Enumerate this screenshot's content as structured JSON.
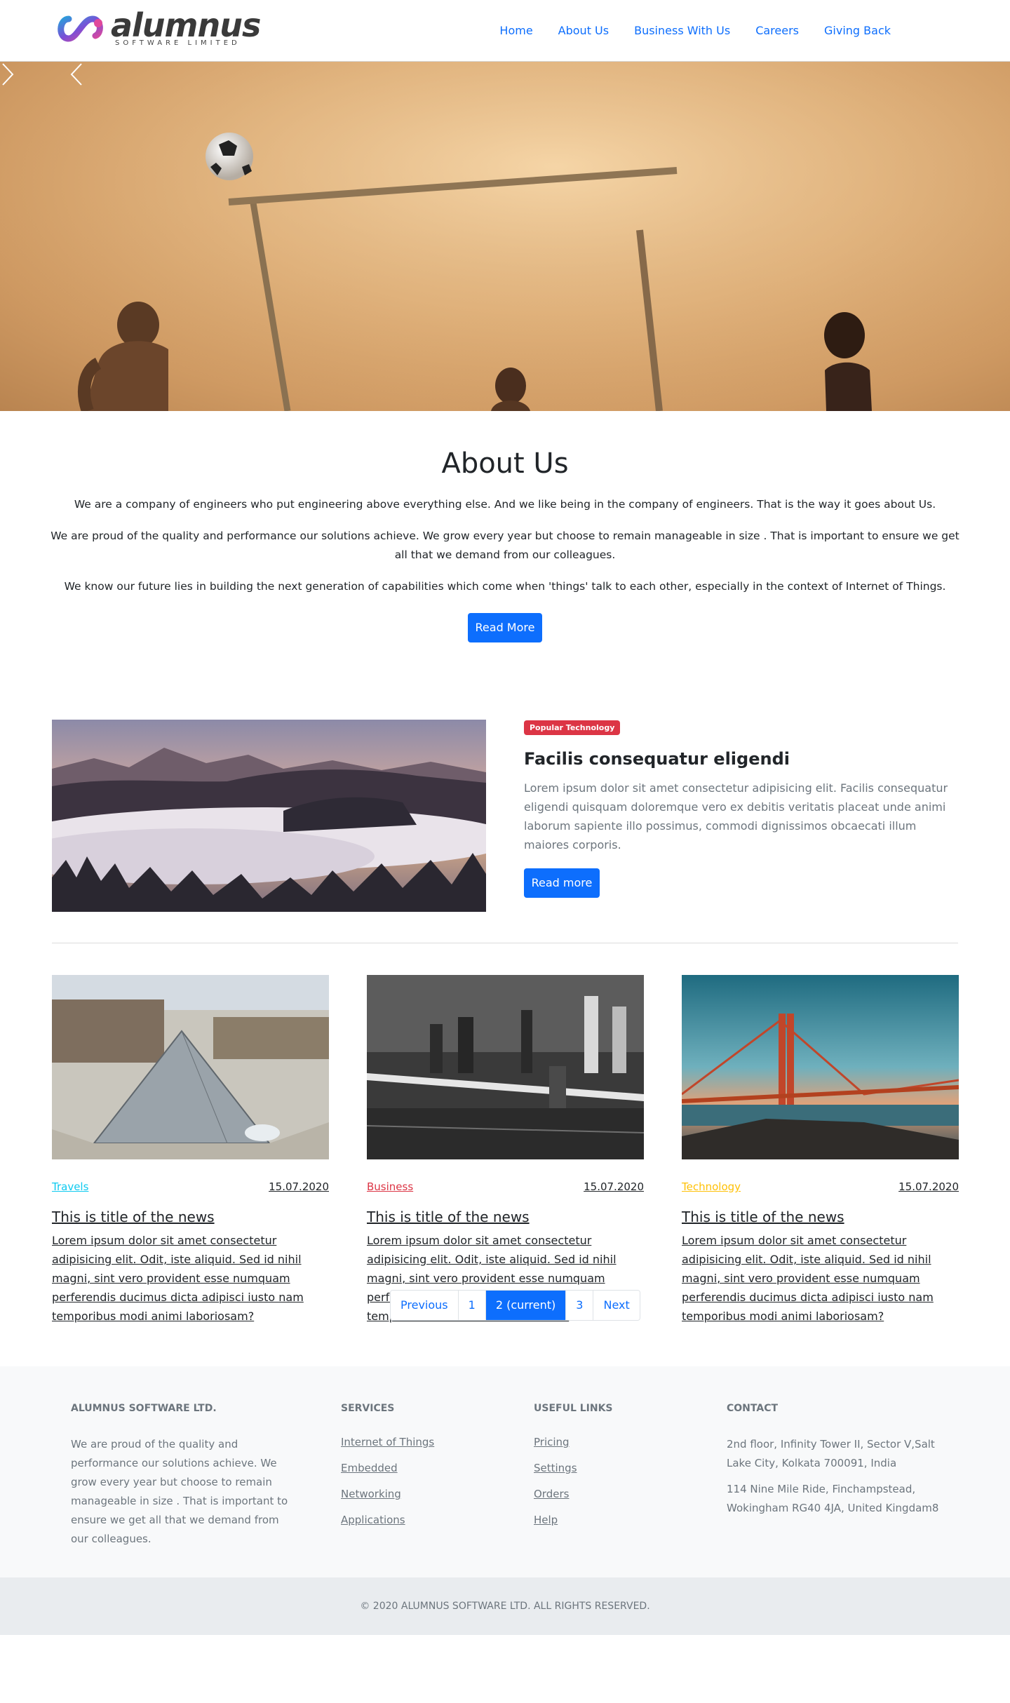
{
  "header": {
    "logo_word": "alumnus",
    "logo_sub": "SOFTWARE LIMITED",
    "nav": [
      "Home",
      "About Us",
      "Business With Us",
      "Careers",
      "Giving Back"
    ]
  },
  "about": {
    "title": "About Us",
    "paragraphs": [
      "We are a company of engineers who put engineering above everything else. And we like being in the company of engineers. That is the way it goes about Us.",
      "We are proud of the quality and performance our solutions achieve. We grow every year but choose to remain manageable in size . That is important to ensure we get all that we demand from our colleagues.",
      "We know our future lies in building the next generation of capabilities which come when 'things' talk to each other, especially in the context of Internet of Things."
    ],
    "button": "Read More"
  },
  "feature": {
    "badge": "Popular Technology",
    "title": "Facilis consequatur eligendi",
    "text": "Lorem ipsum dolor sit amet consectetur adipisicing elit. Facilis consequatur eligendi quisquam doloremque vero ex debitis veritatis placeat unde animi laborum sapiente illo possimus, commodi dignissimos obcaecati illum maiores corporis.",
    "button": "Read more"
  },
  "news": [
    {
      "category": "Travels",
      "category_color": "#0dcaf0",
      "date": "15.07.2020",
      "title": "This is title of the news",
      "text": "Lorem ipsum dolor sit amet consectetur adipisicing elit. Odit, iste aliquid. Sed id nihil magni, sint vero provident esse numquam perferendis ducimus dicta adipisci iusto nam temporibus modi animi laboriosam?"
    },
    {
      "category": "Business",
      "category_color": "#dc3545",
      "date": "15.07.2020",
      "title": "This is title of the news",
      "text": "Lorem ipsum dolor sit amet consectetur adipisicing elit. Odit, iste aliquid. Sed id nihil magni, sint vero provident esse numquam perferendis ducimus dicta adipisci iusto nam temporibus modi animi laboriosam?"
    },
    {
      "category": "Technology",
      "category_color": "#ffc107",
      "date": "15.07.2020",
      "title": "This is title of the news",
      "text": "Lorem ipsum dolor sit amet consectetur adipisicing elit. Odit, iste aliquid. Sed id nihil magni, sint vero provident esse numquam perferendis ducimus dicta adipisci iusto nam temporibus modi animi laboriosam?"
    }
  ],
  "pagination": [
    "Previous",
    "1",
    "2 (current)",
    "3",
    "Next"
  ],
  "footer": {
    "company": {
      "title": "ALUMNUS SOFTWARE LTD.",
      "text": "We are proud of the quality and performance our solutions achieve. We grow every year but choose to remain manageable in size . That is important to ensure we get all that we demand from our colleagues."
    },
    "services": {
      "title": "SERVICES",
      "links": [
        "Internet of Things",
        "Embedded",
        "Networking",
        "Applications"
      ]
    },
    "useful": {
      "title": "USEFUL LINKS",
      "links": [
        "Pricing",
        "Settings",
        "Orders",
        "Help"
      ]
    },
    "contact": {
      "title": "CONTACT",
      "addresses": [
        "2nd floor, Infinity Tower II, Sector V,Salt Lake City, Kolkata 700091, India",
        "114 Nine Mile Ride, Finchampstead, Wokingham RG40 4JA, United Kingdam8"
      ]
    },
    "copyright": "© 2020 ALUMNUS SOFTWARE LTD. ALL RIGHTS RESERVED."
  }
}
